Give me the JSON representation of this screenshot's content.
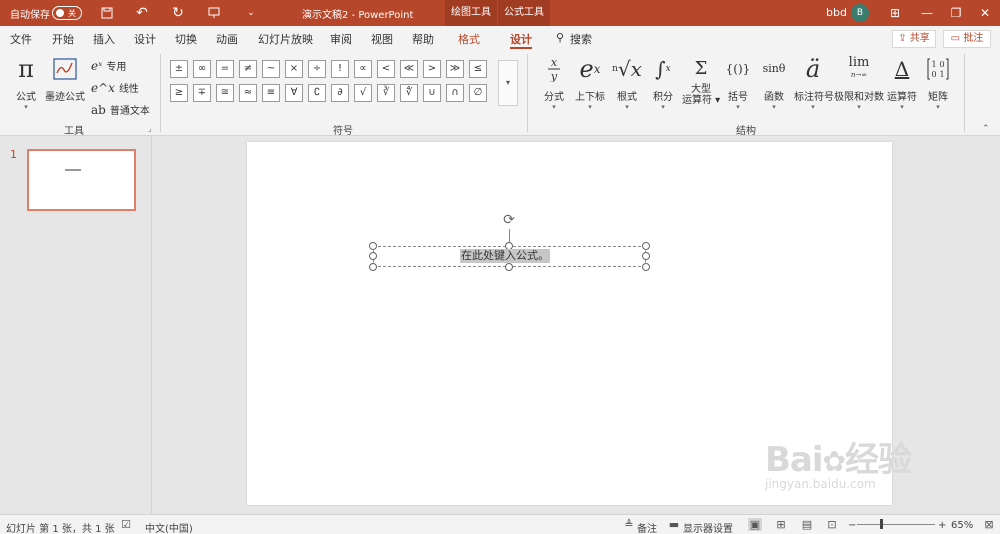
{
  "titlebar": {
    "autosave_label": "自动保存",
    "autosave_state": "关",
    "doc_title": "演示文稿2  -  PowerPoint",
    "context_tabs": [
      "绘图工具",
      "公式工具"
    ],
    "user": "bbd",
    "avatar_initial": "B"
  },
  "menu": {
    "items": [
      "文件",
      "开始",
      "插入",
      "设计",
      "切换",
      "动画",
      "幻灯片放映",
      "审阅",
      "视图",
      "帮助",
      "格式",
      "设计"
    ],
    "search": "搜索",
    "share": "共享",
    "comment": "批注"
  },
  "ribbon": {
    "tools": {
      "formula": "公式",
      "ink": "墨迹公式",
      "professional": "专用",
      "linear": "线性",
      "normal_text": "普通文本",
      "group_label": "工具"
    },
    "symbols": {
      "group_label": "符号",
      "row1": [
        "±",
        "∞",
        "=",
        "≠",
        "~",
        "×",
        "÷",
        "!",
        "∝",
        "<",
        "≪",
        ">",
        "≫",
        "≤"
      ],
      "row2": [
        "≥",
        "∓",
        "≅",
        "≈",
        "≡",
        "∀",
        "∁",
        "∂",
        "√",
        "∛",
        "∜",
        "∪",
        "∩",
        "∅"
      ]
    },
    "structures": {
      "group_label": "结构",
      "items": [
        {
          "glyph": "x/y",
          "label": "分式"
        },
        {
          "glyph": "eˣ",
          "label": "上下标"
        },
        {
          "glyph": "ⁿ√x",
          "label": "根式"
        },
        {
          "glyph": "∫",
          "label": "积分"
        },
        {
          "glyph": "Σ",
          "label": "大型\n运算符"
        },
        {
          "glyph": "{()}",
          "label": "括号"
        },
        {
          "glyph": "sinθ",
          "label": "函数"
        },
        {
          "glyph": "ä",
          "label": "标注符号"
        },
        {
          "glyph": "lim",
          "label": "极限和对数"
        },
        {
          "glyph": "Δ",
          "label": "运算符"
        },
        {
          "glyph": "[10;01]",
          "label": "矩阵"
        }
      ]
    }
  },
  "slides_pane": {
    "slide_number": "1"
  },
  "slide": {
    "equation_placeholder": "在此处键入公式。"
  },
  "statusbar": {
    "slide_info": "幻灯片 第 1 张，共 1 张",
    "language": "中文(中国)",
    "notes": "备注",
    "display_settings": "显示器设置",
    "zoom": "65%"
  },
  "colors": {
    "accent": "#b7472a",
    "ribbon_bg": "#f3f3f3",
    "workspace_bg": "#e6e6e6"
  }
}
